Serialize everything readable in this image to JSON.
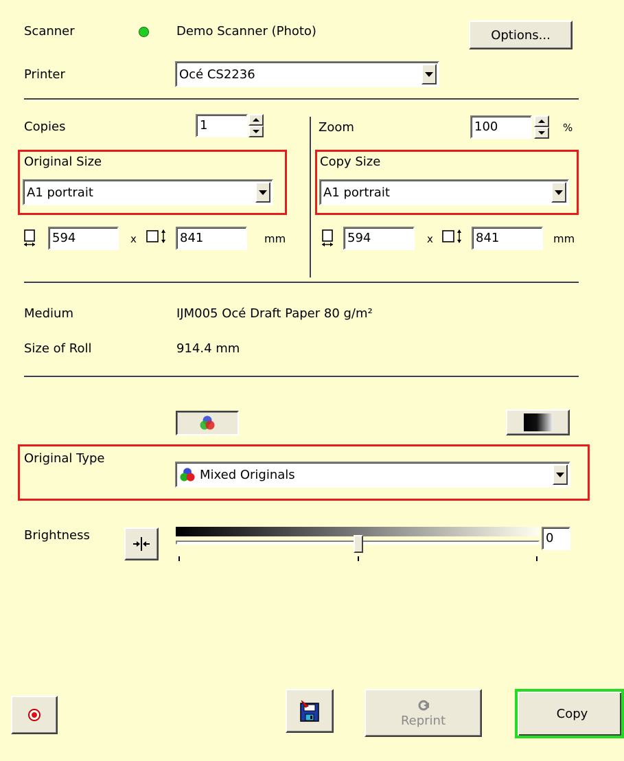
{
  "scanner": {
    "label": "Scanner",
    "status_color": "#22cc22",
    "name": "Demo Scanner (Photo)",
    "options_label": "Options..."
  },
  "printer": {
    "label": "Printer",
    "value": "Océ CS2236"
  },
  "copies": {
    "label": "Copies",
    "value": "1"
  },
  "zoom": {
    "label": "Zoom",
    "value": "100",
    "unit": "%"
  },
  "original_size": {
    "label": "Original Size",
    "value": "A1 portrait",
    "width": "594",
    "x": "x",
    "height": "841",
    "unit": "mm"
  },
  "copy_size": {
    "label": "Copy Size",
    "value": "A1 portrait",
    "width": "594",
    "x": "x",
    "height": "841",
    "unit": "mm"
  },
  "medium": {
    "label": "Medium",
    "value": "IJM005 Océ Draft Paper 80 g/m²"
  },
  "roll": {
    "label": "Size of Roll",
    "value": "914.4 mm"
  },
  "original_type": {
    "label": "Original Type",
    "value": "Mixed Originals",
    "color_icon": "rgb-circles-icon",
    "gray_icon": "grayscale-icon"
  },
  "brightness": {
    "label": "Brightness",
    "value": "0",
    "level": 0.5
  },
  "buttons": {
    "reprint": "Reprint",
    "copy": "Copy"
  },
  "colors": {
    "highlight_red": "#e81c1c",
    "copy_border": "#22dd22",
    "background": "#fdfdd0"
  }
}
